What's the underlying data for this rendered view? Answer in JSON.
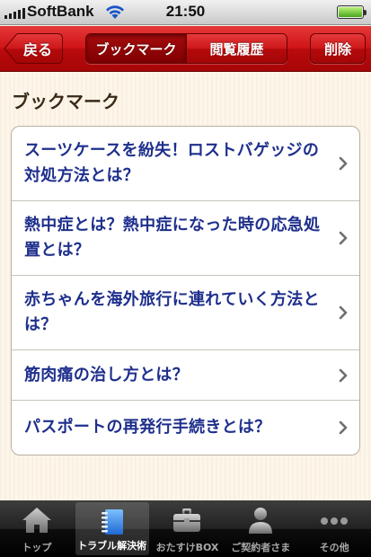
{
  "status_bar": {
    "carrier": "SoftBank",
    "time": "21:50"
  },
  "nav": {
    "back_label": "戻る",
    "segments": [
      {
        "label": "ブックマーク",
        "selected": true
      },
      {
        "label": "閲覧履歴",
        "selected": false
      }
    ],
    "delete_label": "削除"
  },
  "section_title": "ブックマーク",
  "bookmarks": [
    {
      "title": "スーツケースを紛失！ロストバゲッジの対処方法とは？"
    },
    {
      "title": "熱中症とは？熱中症になった時の応急処置とは？"
    },
    {
      "title": "赤ちゃんを海外旅行に連れていく方法とは？"
    },
    {
      "title": "筋肉痛の治し方とは？"
    },
    {
      "title": "パスポートの再発行手続きとは？"
    }
  ],
  "tabs": [
    {
      "label": "トップ",
      "icon": "home-icon",
      "active": false
    },
    {
      "label": "トラブル解決術",
      "icon": "notebook-icon",
      "active": true
    },
    {
      "label": "おたすけBOX",
      "icon": "briefcase-icon",
      "active": false
    },
    {
      "label": "ご契約者さま",
      "icon": "person-icon",
      "active": false
    },
    {
      "label": "その他",
      "icon": "more-icon",
      "active": false
    }
  ],
  "colors": {
    "nav_red": "#cf1416",
    "link_blue": "#1e2f8c",
    "background": "#fdf6ea"
  }
}
